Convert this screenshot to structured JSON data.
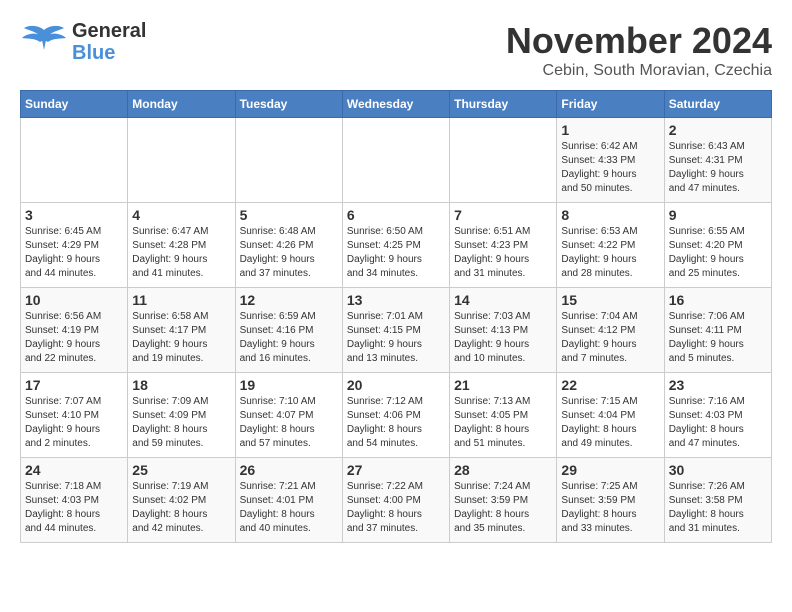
{
  "header": {
    "logo_line1": "General",
    "logo_line2": "Blue",
    "month": "November 2024",
    "location": "Cebin, South Moravian, Czechia"
  },
  "weekdays": [
    "Sunday",
    "Monday",
    "Tuesday",
    "Wednesday",
    "Thursday",
    "Friday",
    "Saturday"
  ],
  "weeks": [
    [
      {
        "day": "",
        "info": ""
      },
      {
        "day": "",
        "info": ""
      },
      {
        "day": "",
        "info": ""
      },
      {
        "day": "",
        "info": ""
      },
      {
        "day": "",
        "info": ""
      },
      {
        "day": "1",
        "info": "Sunrise: 6:42 AM\nSunset: 4:33 PM\nDaylight: 9 hours\nand 50 minutes."
      },
      {
        "day": "2",
        "info": "Sunrise: 6:43 AM\nSunset: 4:31 PM\nDaylight: 9 hours\nand 47 minutes."
      }
    ],
    [
      {
        "day": "3",
        "info": "Sunrise: 6:45 AM\nSunset: 4:29 PM\nDaylight: 9 hours\nand 44 minutes."
      },
      {
        "day": "4",
        "info": "Sunrise: 6:47 AM\nSunset: 4:28 PM\nDaylight: 9 hours\nand 41 minutes."
      },
      {
        "day": "5",
        "info": "Sunrise: 6:48 AM\nSunset: 4:26 PM\nDaylight: 9 hours\nand 37 minutes."
      },
      {
        "day": "6",
        "info": "Sunrise: 6:50 AM\nSunset: 4:25 PM\nDaylight: 9 hours\nand 34 minutes."
      },
      {
        "day": "7",
        "info": "Sunrise: 6:51 AM\nSunset: 4:23 PM\nDaylight: 9 hours\nand 31 minutes."
      },
      {
        "day": "8",
        "info": "Sunrise: 6:53 AM\nSunset: 4:22 PM\nDaylight: 9 hours\nand 28 minutes."
      },
      {
        "day": "9",
        "info": "Sunrise: 6:55 AM\nSunset: 4:20 PM\nDaylight: 9 hours\nand 25 minutes."
      }
    ],
    [
      {
        "day": "10",
        "info": "Sunrise: 6:56 AM\nSunset: 4:19 PM\nDaylight: 9 hours\nand 22 minutes."
      },
      {
        "day": "11",
        "info": "Sunrise: 6:58 AM\nSunset: 4:17 PM\nDaylight: 9 hours\nand 19 minutes."
      },
      {
        "day": "12",
        "info": "Sunrise: 6:59 AM\nSunset: 4:16 PM\nDaylight: 9 hours\nand 16 minutes."
      },
      {
        "day": "13",
        "info": "Sunrise: 7:01 AM\nSunset: 4:15 PM\nDaylight: 9 hours\nand 13 minutes."
      },
      {
        "day": "14",
        "info": "Sunrise: 7:03 AM\nSunset: 4:13 PM\nDaylight: 9 hours\nand 10 minutes."
      },
      {
        "day": "15",
        "info": "Sunrise: 7:04 AM\nSunset: 4:12 PM\nDaylight: 9 hours\nand 7 minutes."
      },
      {
        "day": "16",
        "info": "Sunrise: 7:06 AM\nSunset: 4:11 PM\nDaylight: 9 hours\nand 5 minutes."
      }
    ],
    [
      {
        "day": "17",
        "info": "Sunrise: 7:07 AM\nSunset: 4:10 PM\nDaylight: 9 hours\nand 2 minutes."
      },
      {
        "day": "18",
        "info": "Sunrise: 7:09 AM\nSunset: 4:09 PM\nDaylight: 8 hours\nand 59 minutes."
      },
      {
        "day": "19",
        "info": "Sunrise: 7:10 AM\nSunset: 4:07 PM\nDaylight: 8 hours\nand 57 minutes."
      },
      {
        "day": "20",
        "info": "Sunrise: 7:12 AM\nSunset: 4:06 PM\nDaylight: 8 hours\nand 54 minutes."
      },
      {
        "day": "21",
        "info": "Sunrise: 7:13 AM\nSunset: 4:05 PM\nDaylight: 8 hours\nand 51 minutes."
      },
      {
        "day": "22",
        "info": "Sunrise: 7:15 AM\nSunset: 4:04 PM\nDaylight: 8 hours\nand 49 minutes."
      },
      {
        "day": "23",
        "info": "Sunrise: 7:16 AM\nSunset: 4:03 PM\nDaylight: 8 hours\nand 47 minutes."
      }
    ],
    [
      {
        "day": "24",
        "info": "Sunrise: 7:18 AM\nSunset: 4:03 PM\nDaylight: 8 hours\nand 44 minutes."
      },
      {
        "day": "25",
        "info": "Sunrise: 7:19 AM\nSunset: 4:02 PM\nDaylight: 8 hours\nand 42 minutes."
      },
      {
        "day": "26",
        "info": "Sunrise: 7:21 AM\nSunset: 4:01 PM\nDaylight: 8 hours\nand 40 minutes."
      },
      {
        "day": "27",
        "info": "Sunrise: 7:22 AM\nSunset: 4:00 PM\nDaylight: 8 hours\nand 37 minutes."
      },
      {
        "day": "28",
        "info": "Sunrise: 7:24 AM\nSunset: 3:59 PM\nDaylight: 8 hours\nand 35 minutes."
      },
      {
        "day": "29",
        "info": "Sunrise: 7:25 AM\nSunset: 3:59 PM\nDaylight: 8 hours\nand 33 minutes."
      },
      {
        "day": "30",
        "info": "Sunrise: 7:26 AM\nSunset: 3:58 PM\nDaylight: 8 hours\nand 31 minutes."
      }
    ]
  ]
}
